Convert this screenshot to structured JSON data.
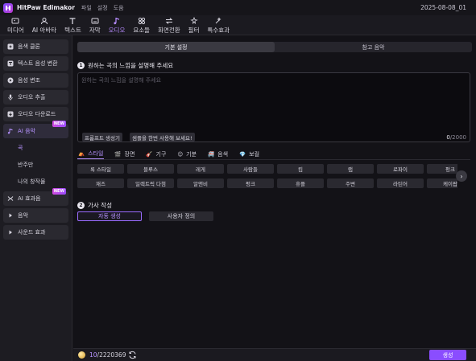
{
  "window": {
    "app_title": "HitPaw Edimakor",
    "menu": [
      "파일",
      "설정",
      "도움"
    ],
    "date": "2025-08-08_01"
  },
  "toolbar": {
    "tabs": [
      {
        "label": "미디어",
        "icon": "media-icon"
      },
      {
        "label": "AI 아바타",
        "icon": "avatar-icon"
      },
      {
        "label": "텍스트",
        "icon": "text-icon"
      },
      {
        "label": "자막",
        "icon": "subtitle-icon"
      },
      {
        "label": "오디오",
        "icon": "audio-icon",
        "active": true
      },
      {
        "label": "요소들",
        "icon": "elements-icon"
      },
      {
        "label": "화면전환",
        "icon": "transition-icon"
      },
      {
        "label": "필터",
        "icon": "filter-icon"
      },
      {
        "label": "특수효과",
        "icon": "effects-icon"
      }
    ],
    "active_color": "#b78cff"
  },
  "sidebar": {
    "items": [
      {
        "label": "음색 클론",
        "icon": "voice-clone-icon"
      },
      {
        "label": "텍스트 음성 변환",
        "icon": "tts-icon"
      },
      {
        "label": "음성 변조",
        "icon": "voice-change-icon"
      },
      {
        "label": "오디오 추출",
        "icon": "mic-icon"
      },
      {
        "label": "오디오 다운로드",
        "icon": "download-icon"
      },
      {
        "label": "AI 음악",
        "icon": "music-icon",
        "active": true,
        "badge": "NEW"
      }
    ],
    "sub_items": [
      {
        "label": "곡",
        "active": true
      },
      {
        "label": "반주만"
      },
      {
        "label": "나의 창작물"
      }
    ],
    "bottom_items": [
      {
        "label": "AI 효과음",
        "icon": "ai-sfx-icon",
        "badge": "NEW"
      },
      {
        "label": "음악",
        "icon": "play-arrow-icon"
      },
      {
        "label": "사운드 효과",
        "icon": "play-arrow-icon"
      }
    ]
  },
  "main": {
    "mode_tabs": [
      "기본 설정",
      "참고 음악"
    ],
    "step1": {
      "num": "1",
      "title": "원하는 곡의 느낌을 설명해 주세요"
    },
    "description": {
      "value": "",
      "placeholder": "원하는 곡의 느낌을 설명해 주세요",
      "chips": [
        "프롬프트 생성기",
        "샘플을 한번 사용해 보세요!"
      ],
      "count": "0",
      "max": "/2000"
    },
    "category_tabs": [
      {
        "label": "스타일",
        "icon": "⛺",
        "active": true
      },
      {
        "label": "장면",
        "icon": "🎬"
      },
      {
        "label": "기구",
        "icon": "🎸"
      },
      {
        "label": "기분",
        "icon": "😊"
      },
      {
        "label": "음색",
        "icon": "🚝"
      },
      {
        "label": "보컬",
        "icon": "💎"
      }
    ],
    "style_tags": [
      "록 스타일",
      "블루스",
      "레게",
      "사람들",
      "킴",
      "랩",
      "로파이",
      "펑크",
      "재즈",
      "일렉트릭 다첨",
      "알앤비",
      "펑크",
      "휴플",
      "주변",
      "라틴어",
      "케이팝"
    ],
    "step2": {
      "num": "2",
      "title": "가사 작성"
    },
    "lyric_modes": [
      "자동 생성",
      "사용자 정의"
    ]
  },
  "bottombar": {
    "credits_used": "10",
    "credits_total": "/2220369",
    "generate_label": "생성",
    "accent": "#8a4dff"
  }
}
